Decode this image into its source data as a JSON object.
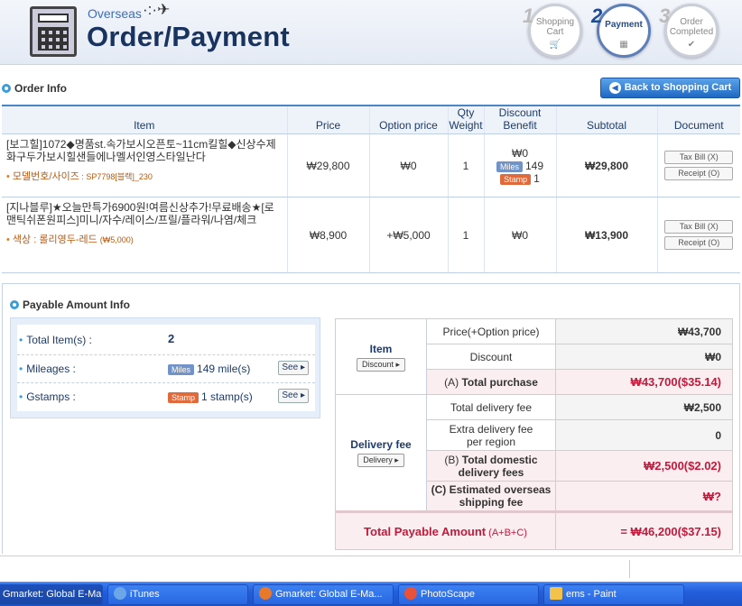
{
  "header": {
    "brand_sub": "Overseas",
    "title": "Order/Payment",
    "steps": [
      {
        "num": "1",
        "label_line1": "Shopping",
        "label_line2": "Cart"
      },
      {
        "num": "2",
        "label_line1": "Payment",
        "label_line2": ""
      },
      {
        "num": "3",
        "label_line1": "Order",
        "label_line2": "Completed"
      }
    ]
  },
  "order_info": {
    "title": "Order Info",
    "back_button": "Back to Shopping Cart",
    "columns": {
      "item": "Item",
      "price": "Price",
      "option_price": "Option price",
      "qty": "Qty",
      "weight": "Weight",
      "discount": "Discount",
      "benefit": "Benefit",
      "subtotal": "Subtotal",
      "document": "Document"
    },
    "rows": [
      {
        "name": "[보그힐]1072◆명품st.속가보시오픈토~11cm킬힐◆신상수제화구두가보시힐샌들에나멜서인영스타일난다",
        "option_label": "모델번호/사이즈",
        "option_value": " : SP7798[블랙]_230",
        "price": "₩29,800",
        "option_price": "₩0",
        "qty": "1",
        "discount": "₩0",
        "miles_tag": "Miles",
        "miles": "149",
        "stamp_tag": "Stamp",
        "stamp": "1",
        "subtotal": "₩29,800",
        "tax_bill": "Tax Bill (X)",
        "receipt": "Receipt (O)"
      },
      {
        "name": "[지나블루]★오늘만특가6900원!여름신상추가!무료배송★[로맨틱쉬폰원피스]미니/자수/레이스/프릴/플라워/나염/체크",
        "option_label": "색상",
        "option_value": " : 롤리영두-레드 ",
        "option_extra": "(₩5,000)",
        "price": "₩8,900",
        "option_price": "+₩5,000",
        "qty": "1",
        "discount": "₩0",
        "subtotal": "₩13,900",
        "tax_bill": "Tax Bill (X)",
        "receipt": "Receipt (O)"
      }
    ]
  },
  "payable": {
    "title": "Payable Amount Info",
    "total_items_label": "Total Item(s) :",
    "total_items": "2",
    "mileages_label": "Mileages :",
    "mileages_tag": "Miles",
    "mileages": "149 mile(s)",
    "gstamps_label": "Gstamps :",
    "gstamps_tag": "Stamp",
    "gstamps": "1 stamp(s)",
    "see_label": "See",
    "item_group": "Item",
    "discount_button": "Discount",
    "price_option_label": "Price(+Option price)",
    "price_option_value": "₩43,700",
    "discount_label": "Discount",
    "discount_value": "₩0",
    "total_purchase_prefix": "(A) ",
    "total_purchase_label": "Total purchase",
    "total_purchase_value": "₩43,700($35.14)",
    "delivery_group": "Delivery fee",
    "delivery_button": "Delivery",
    "total_delivery_label": "Total delivery fee",
    "total_delivery_value": "₩2,500",
    "extra_delivery_label_1": "Extra delivery fee",
    "extra_delivery_label_2": "per region",
    "extra_delivery_value": "0",
    "domestic_prefix": "(B) ",
    "domestic_label_1": "Total domestic",
    "domestic_label_2": "delivery fees",
    "domestic_value": "₩2,500($2.02)",
    "overseas_label_1": "(C) Estimated overseas",
    "overseas_label_2": "shipping fee",
    "overseas_value": "₩?",
    "total_payable_label": "Total Payable Amount",
    "total_payable_formula": " (A+B+C)",
    "total_payable_value": "=  ₩46,200($37.15)"
  },
  "taskbar": {
    "items": [
      "Gmarket: Global E-Ma...",
      "iTunes",
      "Gmarket: Global E-Ma...",
      "PhotoScape",
      "ems - Paint"
    ]
  }
}
